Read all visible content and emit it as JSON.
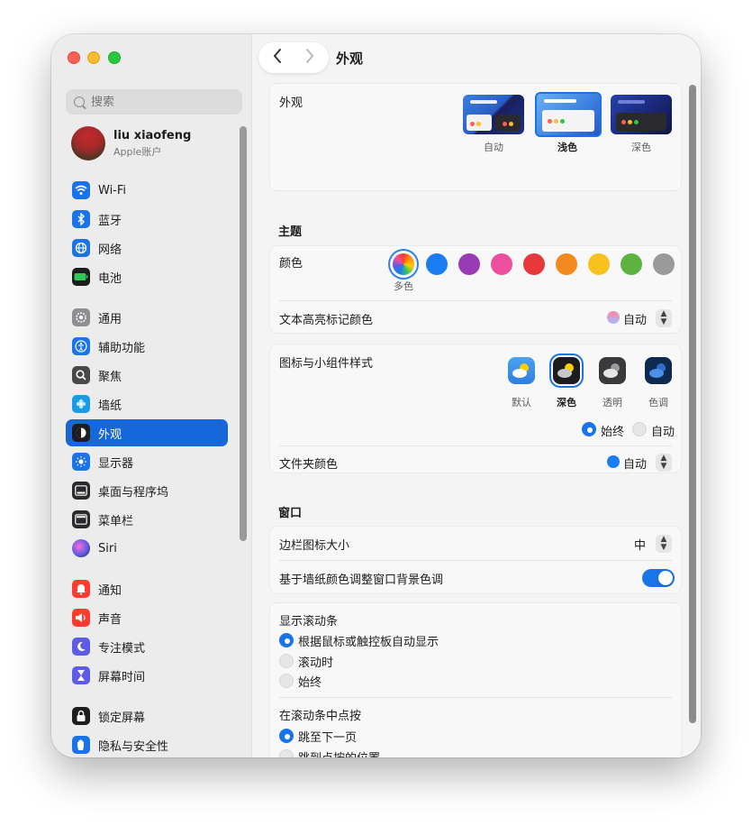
{
  "window": {
    "title": "外观"
  },
  "sidebar": {
    "search_placeholder": "搜索",
    "account": {
      "name": "liu xiaofeng",
      "subtitle": "Apple账户"
    },
    "items": [
      {
        "label": "Wi-Fi",
        "icon": "wifi-icon",
        "color": "#1a73e8"
      },
      {
        "label": "蓝牙",
        "icon": "bluetooth-icon",
        "color": "#1a73e8"
      },
      {
        "label": "网络",
        "icon": "network-globe-icon",
        "color": "#1a73e8"
      },
      {
        "label": "电池",
        "icon": "battery-icon",
        "color": "#2fb84f"
      },
      {
        "label": "通用",
        "icon": "gear-icon",
        "color": "#8e8e93"
      },
      {
        "label": "辅助功能",
        "icon": "accessibility-icon",
        "color": "#1a73e8"
      },
      {
        "label": "聚焦",
        "icon": "magnifier-icon",
        "color": "#5a5a5f"
      },
      {
        "label": "墙纸",
        "icon": "wallpaper-flower-icon",
        "color": "#28a8e8"
      },
      {
        "label": "外观",
        "icon": "appearance-icon",
        "color": "#1d1d1f"
      },
      {
        "label": "显示器",
        "icon": "display-sun-icon",
        "color": "#1a73e8"
      },
      {
        "label": "桌面与程序坞",
        "icon": "dock-icon",
        "color": "#2b2b2e"
      },
      {
        "label": "菜单栏",
        "icon": "menubar-icon",
        "color": "#2b2b2e"
      },
      {
        "label": "Siri",
        "icon": "siri-icon",
        "color": "#7c4dff"
      },
      {
        "label": "通知",
        "icon": "notification-bell-icon",
        "color": "#ff3b30"
      },
      {
        "label": "声音",
        "icon": "speaker-icon",
        "color": "#ff3b30"
      },
      {
        "label": "专注模式",
        "icon": "moon-icon",
        "color": "#5e5ce6"
      },
      {
        "label": "屏幕时间",
        "icon": "hourglass-icon",
        "color": "#5e5ce6"
      },
      {
        "label": "锁定屏幕",
        "icon": "lock-icon",
        "color": "#1d1d1f"
      },
      {
        "label": "隐私与安全性",
        "icon": "hand-icon",
        "color": "#1a73e8"
      }
    ]
  },
  "appearance": {
    "label": "外观",
    "options": [
      {
        "label": "自动",
        "selected": false
      },
      {
        "label": "浅色",
        "selected": true
      },
      {
        "label": "深色",
        "selected": false
      }
    ]
  },
  "theme": {
    "section_title": "主题",
    "color_label": "颜色",
    "color_selected_label": "多色",
    "colors": [
      "#1a7ef2",
      "#9b3ab5",
      "#ec4f9e",
      "#e6373a",
      "#f28a20",
      "#f7c21d",
      "#5db342",
      "#9a9a9a"
    ],
    "highlight_label": "文本高亮标记颜色",
    "highlight_value": "自动",
    "icon_style_label": "图标与小组件样式",
    "icon_styles": [
      {
        "label": "默认",
        "selected": false
      },
      {
        "label": "深色",
        "selected": true
      },
      {
        "label": "透明",
        "selected": false
      },
      {
        "label": "色调",
        "selected": false
      }
    ],
    "icon_mode": [
      {
        "label": "始终",
        "selected": true
      },
      {
        "label": "自动",
        "selected": false
      }
    ],
    "folder_color_label": "文件夹颜色",
    "folder_color_value": "自动"
  },
  "window_section": {
    "section_title": "窗口",
    "sidebar_icon_size_label": "边栏图标大小",
    "sidebar_icon_size_value": "中",
    "tint_label": "基于墙纸颜色调整窗口背景色调",
    "tint_on": true
  },
  "scrollbars": {
    "show_label": "显示滚动条",
    "show_options": [
      {
        "label": "根据鼠标或触控板自动显示",
        "selected": true
      },
      {
        "label": "滚动时",
        "selected": false
      },
      {
        "label": "始终",
        "selected": false
      }
    ],
    "click_label": "在滚动条中点按",
    "click_options": [
      {
        "label": "跳至下一页",
        "selected": true
      },
      {
        "label": "跳到点按的位置",
        "selected": false
      }
    ]
  }
}
